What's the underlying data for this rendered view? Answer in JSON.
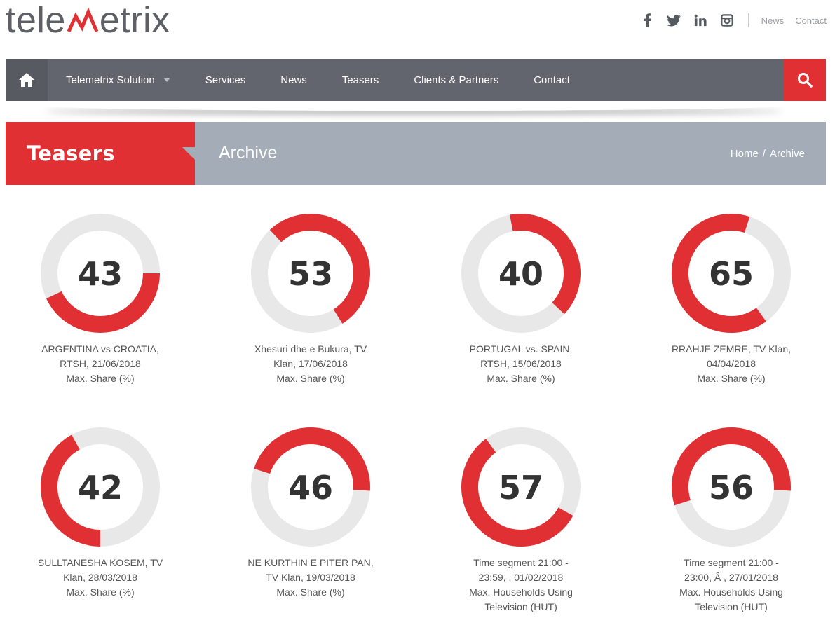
{
  "brand": {
    "logo_text_left": "tele",
    "logo_text_right": "etrix",
    "accent": "#e03033",
    "nav_bg": "#62656d",
    "banner_bg": "#a4adb7"
  },
  "top_links": [
    "News",
    "Contact"
  ],
  "social_icons": [
    "facebook-icon",
    "twitter-icon",
    "linkedin-icon",
    "instagram-icon"
  ],
  "nav": {
    "items": [
      "Telemetrix Solution",
      "Services",
      "News",
      "Teasers",
      "Clients & Partners",
      "Contact"
    ]
  },
  "banner": {
    "title": "Teasers",
    "subtitle": "Archive",
    "breadcrumb_home": "Home",
    "breadcrumb_sep": "/",
    "breadcrumb_current": "Archive"
  },
  "teasers": [
    {
      "value": 43,
      "start": 0.25,
      "line1": "ARGENTINA vs CROATIA,",
      "line2": "RTSH, 21/06/2018",
      "line3": "Max. Share (%)",
      "line4": ""
    },
    {
      "value": 53,
      "start": 0.88,
      "line1": "Xhesuri dhe e Bukura, TV",
      "line2": "Klan, 17/06/2018",
      "line3": "Max. Share (%)",
      "line4": ""
    },
    {
      "value": 40,
      "start": 0.97,
      "line1": "PORTUGAL vs. SPAIN,",
      "line2": "RTSH, 15/06/2018",
      "line3": "Max. Share (%)",
      "line4": ""
    },
    {
      "value": 65,
      "start": 0.4,
      "line1": "RRAHJE ZEMRE, TV Klan,",
      "line2": "04/04/2018",
      "line3": "Max. Share (%)",
      "line4": ""
    },
    {
      "value": 42,
      "start": 0.5,
      "line1": "SULLTANESHA KOSEM, TV",
      "line2": "Klan, 28/03/2018",
      "line3": "Max. Share (%)",
      "line4": ""
    },
    {
      "value": 46,
      "start": 0.8,
      "line1": "NE KURTHIN E PITER PAN,",
      "line2": "TV Klan, 19/03/2018",
      "line3": "Max. Share (%)",
      "line4": ""
    },
    {
      "value": 57,
      "start": 0.33,
      "line1": "Time segment 21:00 -",
      "line2": "23:59, , 01/02/2018",
      "line3": "Max. Households Using",
      "line4": "Television (HUT)"
    },
    {
      "value": 56,
      "start": 0.7,
      "line1": "Time segment 21:00 -",
      "line2": "23:00, Â , 27/01/2018",
      "line3": "Max. Households Using",
      "line4": "Television (HUT)"
    }
  ]
}
